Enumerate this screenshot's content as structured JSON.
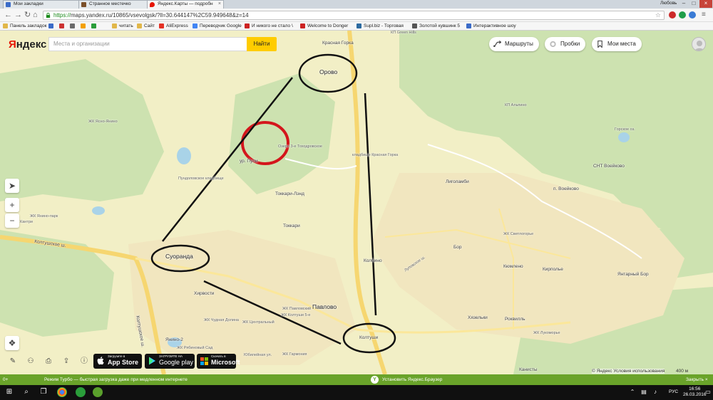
{
  "browser": {
    "tabs": [
      {
        "title": "Мои закладки",
        "color": "#3b6bc8"
      },
      {
        "title": "Странное местечко",
        "color": "#7a4f2a"
      },
      {
        "title": "Яндекс.Карты — подробн",
        "color": "#e61400"
      }
    ],
    "window_user": "Любовь",
    "url_https": "https://",
    "url_rest": "maps.yandex.ru/10865/vsevolgsk/?ll=30.644147%2C59.949648&z=14",
    "bookmarks": [
      {
        "label": "Панель закладок",
        "color": "#e1b74a"
      },
      {
        "label": "",
        "color": "#3b6bc8"
      },
      {
        "label": "",
        "color": "#c33"
      },
      {
        "label": "",
        "color": "#6a6a6a"
      },
      {
        "label": "",
        "color": "#f3a000"
      },
      {
        "label": "",
        "color": "#2a9d3a"
      },
      {
        "label": "читать",
        "color": "#e1b74a"
      },
      {
        "label": "Сайт",
        "color": "#e1b74a"
      },
      {
        "label": "AliExpress",
        "color": "#e43226"
      },
      {
        "label": "Переводчик Google",
        "color": "#4285f4"
      },
      {
        "label": "И никого не стало \\",
        "color": "#cc2222"
      },
      {
        "label": "Welcome to Donger",
        "color": "#cc2222"
      },
      {
        "label": "Supl.biz - Торговая",
        "color": "#2c6aa0"
      },
      {
        "label": "Золотой кувшинк 5",
        "color": "#555"
      },
      {
        "label": "Интерактивное шоу",
        "color": "#3b6bc8"
      }
    ]
  },
  "yandex": {
    "logo_ya": "Я",
    "logo_rest": "ндекс",
    "search_placeholder": "Места и организации",
    "find_button": "Найти",
    "routes": "Маршруты",
    "traffic": "Пробки",
    "my_places": "Мои места",
    "copyright": "© Яндекс Условия использования",
    "scale": "400 м",
    "stores": [
      {
        "line1": "Загрузите в",
        "line2": "App Store"
      },
      {
        "line1": "ЗАГРУЗИТЕ НА",
        "line2": "Google play"
      },
      {
        "line1": "Скачать в",
        "line2": "Microsoft"
      }
    ]
  },
  "map_labels": {
    "orovo": "Орово",
    "krasnaya_gorka": "Красная Горка",
    "kp_green_hills": "КП Green Hills",
    "kp_alpino": "КП Альпино",
    "zhk_yasno_yanino": "ЖК Ясно-Янино",
    "ozero": "Озеро 3-е Тоходровское",
    "ur_puli": "ур. Пули",
    "kladbishche_kg": "кладбище Красная Горка",
    "pundolovskoe": "Пундоловское кладбище",
    "tokkari_land": "Токкари-Лэнд",
    "tokkari": "Токкари",
    "ligolambi": "Лиголамби",
    "snt_voeikovo": "СНТ Воейково",
    "p_voeikovo": "п. Воейково",
    "gorskoe_oz": "Горское оз.",
    "zhk_yanino_park": "ЖК Янино-парк",
    "kantri": "Кантри",
    "koltushskoe_sh": "Колтушское ш.",
    "koltushskoe_sh2": "Колтушское ш.",
    "suoranda": "Суоранда",
    "khirvosti": "Хирвости",
    "pavlovo": "Павлово",
    "kolbino": "Колбино",
    "bor": "Бор",
    "zhk_svetlogorye": "ЖК Светлогорье",
    "kyumleno": "Кюмлено",
    "kirpolye": "Кирполье",
    "yantarny_bor": "Янтарный Бор",
    "zhk_pavlovsky": "ЖК Павловский",
    "zhk_koltushi": "ЖК Колтуши 5-е",
    "zhk_chudnaya": "ЖК Чудная Долина",
    "zhk_centralny": "ЖК Центральный",
    "yanino2": "Янино-2",
    "zhk_rybinsky": "ЖК Рябиновый Сад",
    "yubileynaya": "Юбилейная ул.",
    "zhk_garmonia": "ЖК Гармония",
    "koltushi": "Колтуши",
    "khyazelki": "Хязельки",
    "rokvill": "Роквилль",
    "lukomorye": "ЖК Лукоморье",
    "kanisty": "Канисты",
    "lupovo": "Луповское ш."
  },
  "statusbar": {
    "left": "0+",
    "message": "Режим Турбо — быстрая загрузка даже при медленном интернете",
    "install": "Установить Яндекс.Браузер",
    "close": "Закрыть ×"
  },
  "taskbar": {
    "lang": "РУС",
    "time": "16:56",
    "date": "26.03.2016"
  },
  "colors": {
    "land": "#f2efc6",
    "forest": "#cde2b0",
    "settlement": "#f1e6bf",
    "road": "#fbe79a",
    "accent": "#ffcc00",
    "statusbar": "#6aa32a"
  }
}
